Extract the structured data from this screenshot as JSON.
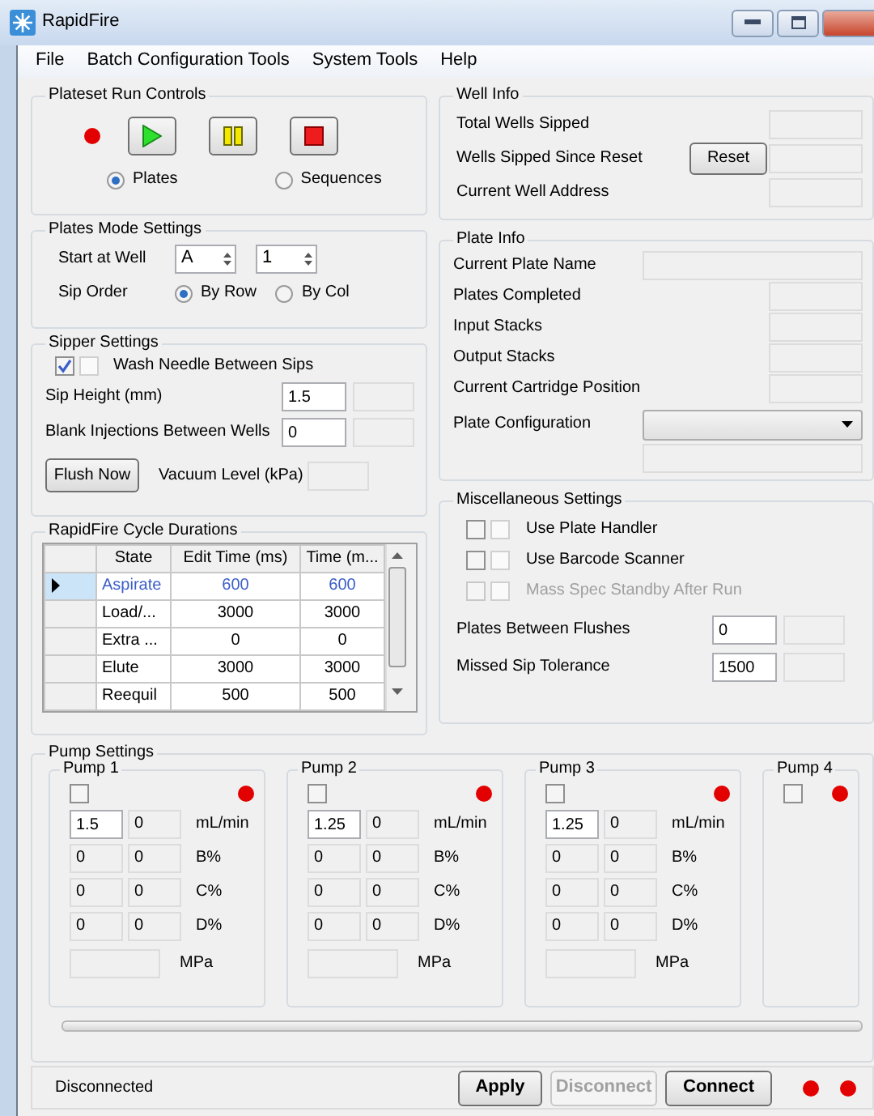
{
  "window": {
    "title": "RapidFire"
  },
  "menu": [
    "File",
    "Batch Configuration Tools",
    "System Tools",
    "Help"
  ],
  "run_controls": {
    "title": "Plateset Run Controls",
    "modes": [
      {
        "label": "Plates",
        "selected": true
      },
      {
        "label": "Sequences",
        "selected": false
      }
    ]
  },
  "plates_mode": {
    "title": "Plates Mode Settings",
    "start_label": "Start at Well",
    "row": "A",
    "column": "1",
    "order_label": "Sip Order",
    "order": [
      {
        "label": "By Row",
        "selected": true
      },
      {
        "label": "By Col",
        "selected": false
      }
    ]
  },
  "sipper": {
    "title": "Sipper Settings",
    "wash": {
      "label": "Wash Needle Between Sips",
      "checked": true
    },
    "fields": [
      {
        "label": "Sip Height (mm)",
        "value": "1.5"
      },
      {
        "label": "Blank Injections Between Wells",
        "value": "0"
      }
    ],
    "flush_button": "Flush Now",
    "vacuum_label": "Vacuum Level (kPa)"
  },
  "cycle": {
    "title": "RapidFire Cycle Durations",
    "columns": [
      "State",
      "Edit Time (ms)",
      "Time (m..."
    ],
    "rows": [
      {
        "state": "Aspirate",
        "edit_time": "600",
        "time": "600",
        "selected": true
      },
      {
        "state": "Load/...",
        "edit_time": "3000",
        "time": "3000",
        "selected": false
      },
      {
        "state": "Extra ...",
        "edit_time": "0",
        "time": "0",
        "selected": false
      },
      {
        "state": "Elute",
        "edit_time": "3000",
        "time": "3000",
        "selected": false
      },
      {
        "state": "Reequil",
        "edit_time": "500",
        "time": "500",
        "selected": false
      }
    ]
  },
  "well_info": {
    "title": "Well Info",
    "rows": [
      {
        "label": "Total Wells Sipped"
      },
      {
        "label": "Wells Sipped Since Reset",
        "button": "Reset"
      },
      {
        "label": "Current Well Address"
      }
    ]
  },
  "plate_info": {
    "title": "Plate Info",
    "rows": [
      {
        "label": "Current Plate Name",
        "kind": "wide"
      },
      {
        "label": "Plates Completed",
        "kind": "short"
      },
      {
        "label": "Input Stacks",
        "kind": "short"
      },
      {
        "label": "Output Stacks",
        "kind": "short"
      },
      {
        "label": "Current Cartridge Position",
        "kind": "short"
      },
      {
        "label": "Plate Configuration",
        "kind": "select"
      }
    ]
  },
  "misc": {
    "title": "Miscellaneous Settings",
    "options": [
      {
        "label": "Use Plate Handler",
        "checked": false,
        "disabled": false
      },
      {
        "label": "Use Barcode Scanner",
        "checked": false,
        "disabled": false
      },
      {
        "label": "Mass Spec Standby After Run",
        "checked": false,
        "disabled": true
      }
    ],
    "fields": [
      {
        "label": "Plates Between Flushes",
        "value": "0"
      },
      {
        "label": "Missed Sip Tolerance",
        "value": "1500"
      }
    ]
  },
  "pumps": {
    "title": "Pump Settings",
    "items": [
      {
        "name": "Pump 1",
        "enabled": false,
        "rows": [
          {
            "value": "1.5",
            "actual": "0",
            "unit": "mL/min",
            "editable": true
          },
          {
            "value": "0",
            "actual": "0",
            "unit": "B%",
            "editable": false
          },
          {
            "value": "0",
            "actual": "0",
            "unit": "C%",
            "editable": false
          },
          {
            "value": "0",
            "actual": "0",
            "unit": "D%",
            "editable": false
          }
        ],
        "pressure_unit": "MPa"
      },
      {
        "name": "Pump 2",
        "enabled": false,
        "rows": [
          {
            "value": "1.25",
            "actual": "0",
            "unit": "mL/min",
            "editable": true
          },
          {
            "value": "0",
            "actual": "0",
            "unit": "B%",
            "editable": false
          },
          {
            "value": "0",
            "actual": "0",
            "unit": "C%",
            "editable": false
          },
          {
            "value": "0",
            "actual": "0",
            "unit": "D%",
            "editable": false
          }
        ],
        "pressure_unit": "MPa"
      },
      {
        "name": "Pump 3",
        "enabled": false,
        "rows": [
          {
            "value": "1.25",
            "actual": "0",
            "unit": "mL/min",
            "editable": true
          },
          {
            "value": "0",
            "actual": "0",
            "unit": "B%",
            "editable": false
          },
          {
            "value": "0",
            "actual": "0",
            "unit": "C%",
            "editable": false
          },
          {
            "value": "0",
            "actual": "0",
            "unit": "D%",
            "editable": false
          }
        ],
        "pressure_unit": "MPa"
      },
      {
        "name": "Pump 4",
        "enabled": false
      }
    ]
  },
  "status_bar": {
    "text": "Disconnected",
    "buttons": [
      {
        "label": "Apply",
        "disabled": false
      },
      {
        "label": "Disconnect",
        "disabled": true
      },
      {
        "label": "Connect",
        "disabled": false
      }
    ]
  }
}
